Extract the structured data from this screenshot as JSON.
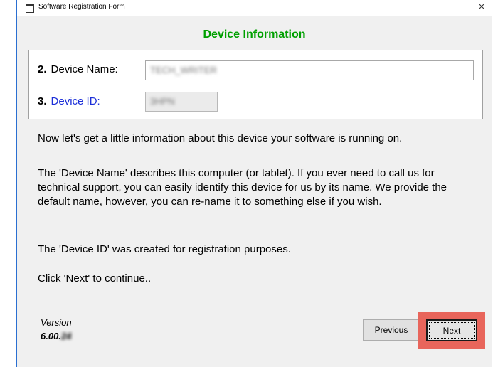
{
  "window": {
    "title": "Software Registration Form",
    "close_glyph": "×"
  },
  "heading": "Device Information",
  "fields": {
    "device_name": {
      "number": "2.",
      "label": "Device Name:",
      "value": "TECH_WRITER"
    },
    "device_id": {
      "number": "3.",
      "label": "Device ID:",
      "value": "3HPN"
    }
  },
  "body": {
    "intro": "Now let's get a little information about this device your software is running on.",
    "device_name_desc": "The 'Device Name' describes this computer (or tablet).  If you ever need to call us for technical support, you can easily identify this device for us by its name. We provide the default name, however, you can re-name it to something else if you wish.",
    "device_id_desc": "The 'Device ID' was created for registration purposes.",
    "continue": "Click 'Next' to continue.."
  },
  "footer": {
    "version_label": "Version",
    "version_number": "6.00.",
    "version_suffix_blurred": "24"
  },
  "buttons": {
    "previous": "Previous",
    "next": "Next"
  },
  "colors": {
    "heading": "#00a000",
    "device_id_label": "#1c2fd8",
    "highlight": "#e8655b"
  },
  "icons": {
    "app": "form-window-icon",
    "close": "close-icon"
  }
}
